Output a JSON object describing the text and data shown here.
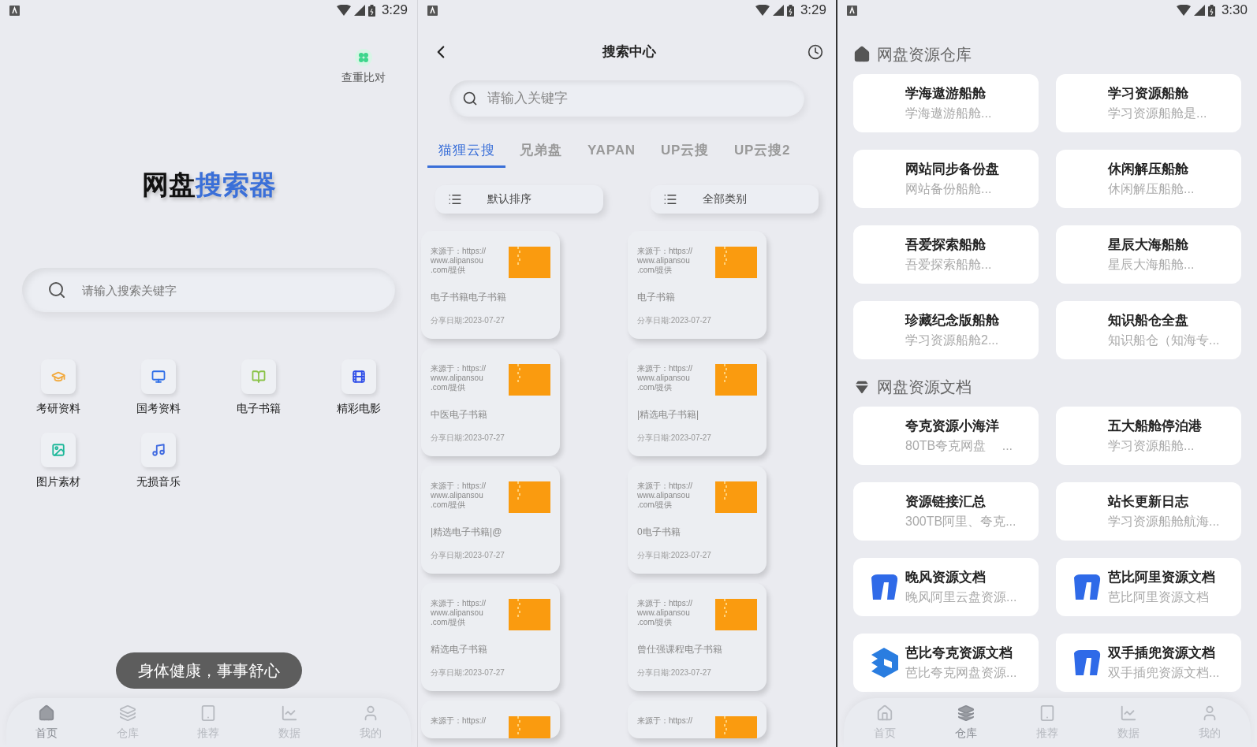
{
  "home": {
    "status_bar": {
      "time": "3:29"
    },
    "top_action": {
      "label": "查重比对"
    },
    "title": {
      "dark": "网盘",
      "accent": "搜索器"
    },
    "search": {
      "placeholder": "请输入搜索关键字"
    },
    "categories": [
      {
        "label": "考研资料",
        "kind": "cap",
        "color": "#f2a93b"
      },
      {
        "label": "国考资料",
        "kind": "monitor",
        "color": "#2f6fe8"
      },
      {
        "label": "电子书籍",
        "kind": "book",
        "color": "#8bc34a"
      },
      {
        "label": "精彩电影",
        "kind": "film",
        "color": "#2f4ee8"
      },
      {
        "label": "图片素材",
        "kind": "image",
        "color": "#1fb89a"
      },
      {
        "label": "无损音乐",
        "kind": "music",
        "color": "#3f6ae0"
      }
    ],
    "toast": "身体健康，事事舒心",
    "nav": [
      {
        "label": "首页",
        "kind": "home",
        "selected": true
      },
      {
        "label": "仓库",
        "kind": "layers",
        "selected": false
      },
      {
        "label": "推荐",
        "kind": "tablet",
        "selected": false
      },
      {
        "label": "数据",
        "kind": "chart",
        "selected": false
      },
      {
        "label": "我的",
        "kind": "user",
        "selected": false
      }
    ]
  },
  "search_center": {
    "status_bar": {
      "time": "3:29"
    },
    "title": "搜索中心",
    "search": {
      "placeholder": "请输入关键字"
    },
    "tabs": [
      {
        "label": "猫狸云搜",
        "selected": true
      },
      {
        "label": "兄弟盘",
        "selected": false
      },
      {
        "label": "YAPAN",
        "selected": false
      },
      {
        "label": "UP云搜",
        "selected": false
      },
      {
        "label": "UP云搜2",
        "selected": false
      }
    ],
    "filters": [
      {
        "label": "默认排序"
      },
      {
        "label": "全部类别"
      }
    ],
    "results": [
      {
        "source": [
          "来源于：https://",
          "www.alipansou",
          ".com/提供"
        ],
        "title": "电子书籍电子书籍",
        "date": "分享日期:2023-07-27"
      },
      {
        "source": [
          "来源于：https://",
          "www.alipansou",
          ".com/提供"
        ],
        "title": "电子书籍",
        "date": "分享日期:2023-07-27"
      },
      {
        "source": [
          "来源于：https://",
          "www.alipansou",
          ".com/提供"
        ],
        "title": "中医电子书籍",
        "date": "分享日期:2023-07-27"
      },
      {
        "source": [
          "来源于：https://",
          "www.alipansou",
          ".com/提供"
        ],
        "title": "|精选电子书籍|",
        "date": "分享日期:2023-07-27"
      },
      {
        "source": [
          "来源于：https://",
          "www.alipansou",
          ".com/提供"
        ],
        "title": "|精选电子书籍|@",
        "date": "分享日期:2023-07-27"
      },
      {
        "source": [
          "来源于：https://",
          "www.alipansou",
          ".com/提供"
        ],
        "title": "0电子书籍",
        "date": "分享日期:2023-07-27"
      },
      {
        "source": [
          "来源于：https://",
          "www.alipansou",
          ".com/提供"
        ],
        "title": "精选电子书籍",
        "date": "分享日期:2023-07-27"
      },
      {
        "source": [
          "来源于：https://",
          "www.alipansou",
          ".com/提供"
        ],
        "title": "曾仕强课程电子书籍",
        "date": "分享日期:2023-07-27"
      },
      {
        "source": [
          "来源于：https://"
        ]
      },
      {
        "source": [
          "来源于：https://"
        ]
      }
    ]
  },
  "warehouse": {
    "status_bar": {
      "time": "3:30"
    },
    "sections": [
      {
        "title": "网盘资源仓库",
        "kind": "house",
        "items": [
          {
            "name": "学海遨游船舱",
            "desc": "学海遨游船舱..."
          },
          {
            "name": "学习资源船舱",
            "desc": "学习资源船舱是..."
          },
          {
            "name": "网站同步备份盘",
            "desc": "网站备份船舱..."
          },
          {
            "name": "休闲解压船舱",
            "desc": "休闲解压船舱..."
          },
          {
            "name": "吾爱探索船舱",
            "desc": "吾爱探索船舱..."
          },
          {
            "name": "星辰大海船舱",
            "desc": "星辰大海船舱..."
          },
          {
            "name": "珍藏纪念版船舱",
            "desc": "学习资源船舱2..."
          },
          {
            "name": "知识船仓全盘",
            "desc": "知识船仓（知海专..."
          }
        ]
      },
      {
        "title": "网盘资源文档",
        "kind": "gem",
        "items": [
          {
            "name": "夸克资源小海洋",
            "desc": "80TB夸克网盘　 ..."
          },
          {
            "name": "五大船舱停泊港",
            "desc": "学习资源船舱..."
          },
          {
            "name": "资源链接汇总",
            "desc": "300TB阿里、夸克..."
          },
          {
            "name": "站长更新日志",
            "desc": "学习资源船舱航海..."
          },
          {
            "name": "晚风资源文档",
            "desc": "晚风阿里云盘资源...",
            "kind": "arrow"
          },
          {
            "name": "芭比阿里资源文档",
            "desc": "芭比阿里资源文档",
            "kind": "arrow"
          },
          {
            "name": "芭比夸克资源文档",
            "desc": "芭比夸克网盘资源...",
            "kind": "cube"
          },
          {
            "name": "双手插兜资源文档",
            "desc": "双手插兜资源文档...",
            "kind": "arrow"
          }
        ]
      }
    ],
    "nav": [
      {
        "label": "首页",
        "kind": "home",
        "selected": false
      },
      {
        "label": "仓库",
        "kind": "layers",
        "selected": true
      },
      {
        "label": "推荐",
        "kind": "tablet",
        "selected": false
      },
      {
        "label": "数据",
        "kind": "chart",
        "selected": false
      },
      {
        "label": "我的",
        "kind": "user",
        "selected": false
      }
    ]
  }
}
